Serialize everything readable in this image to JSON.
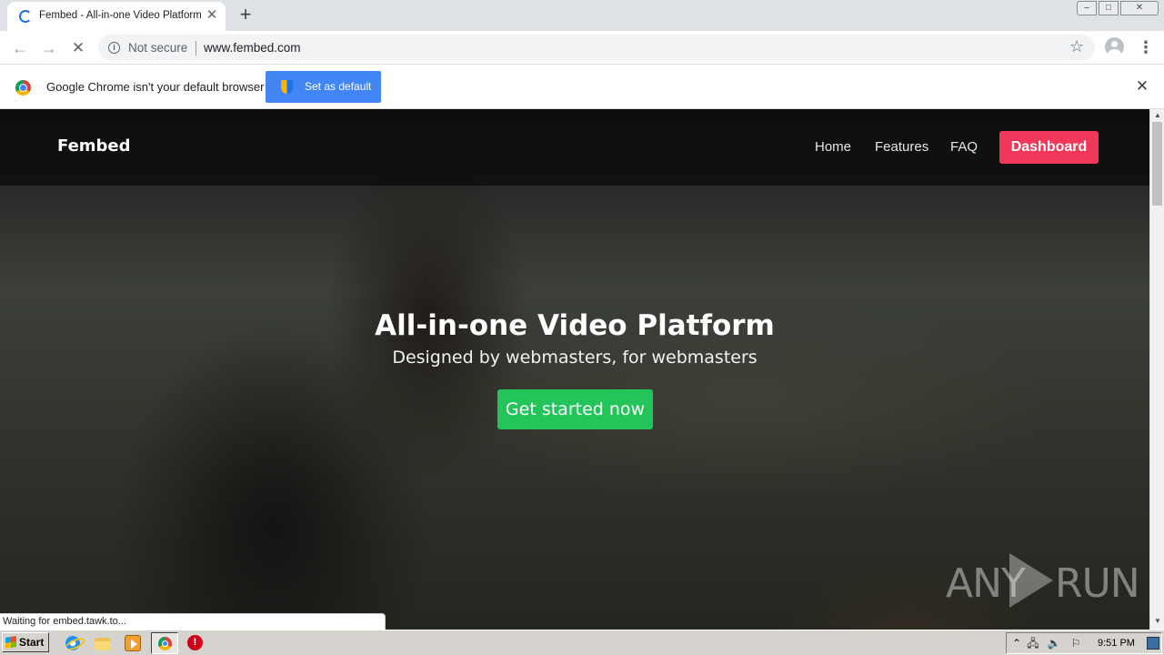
{
  "browser": {
    "tab": {
      "title": "Fembed - All-in-one Video Platform",
      "close_glyph": "✕"
    },
    "new_tab_glyph": "+",
    "window_controls": {
      "minimize": "–",
      "maximize": "□",
      "close": "✕"
    },
    "nav": {
      "back": "←",
      "forward": "→",
      "stop": "✕"
    },
    "omnibox": {
      "security_label": "Not secure",
      "info_glyph": "i",
      "url": "www.fembed.com",
      "star_glyph": "☆"
    },
    "menu_glyph": "⋮",
    "infobar": {
      "message": "Google Chrome isn't your default browser",
      "button_label": "Set as default",
      "close_glyph": "✕"
    },
    "status_text": "Waiting for embed.tawk.to..."
  },
  "site": {
    "brand": "Fembed",
    "nav_links": [
      {
        "label": "Home"
      },
      {
        "label": "Features"
      },
      {
        "label": "FAQ"
      }
    ],
    "dashboard_label": "Dashboard",
    "hero": {
      "title": "All-in-one Video Platform",
      "subtitle": "Designed by webmasters, for webmasters",
      "cta_label": "Get started now"
    },
    "watermark": {
      "left": "ANY",
      "right": "RUN"
    },
    "colors": {
      "dashboard": "#f2385a",
      "cta": "#23c45a",
      "nav_bg": "#0a0a0a"
    }
  },
  "scrollbar": {
    "up": "▲",
    "down": "▼"
  },
  "taskbar": {
    "start_label": "Start",
    "stop_glyph": "!",
    "tray": {
      "expand": "⌃",
      "network": "🖧",
      "volume": "🔈",
      "flag": "⚐",
      "time": "9:51 PM"
    },
    "icons": [
      "ie-icon",
      "folder-icon",
      "media-player-icon",
      "chrome-icon",
      "stop-icon"
    ]
  }
}
